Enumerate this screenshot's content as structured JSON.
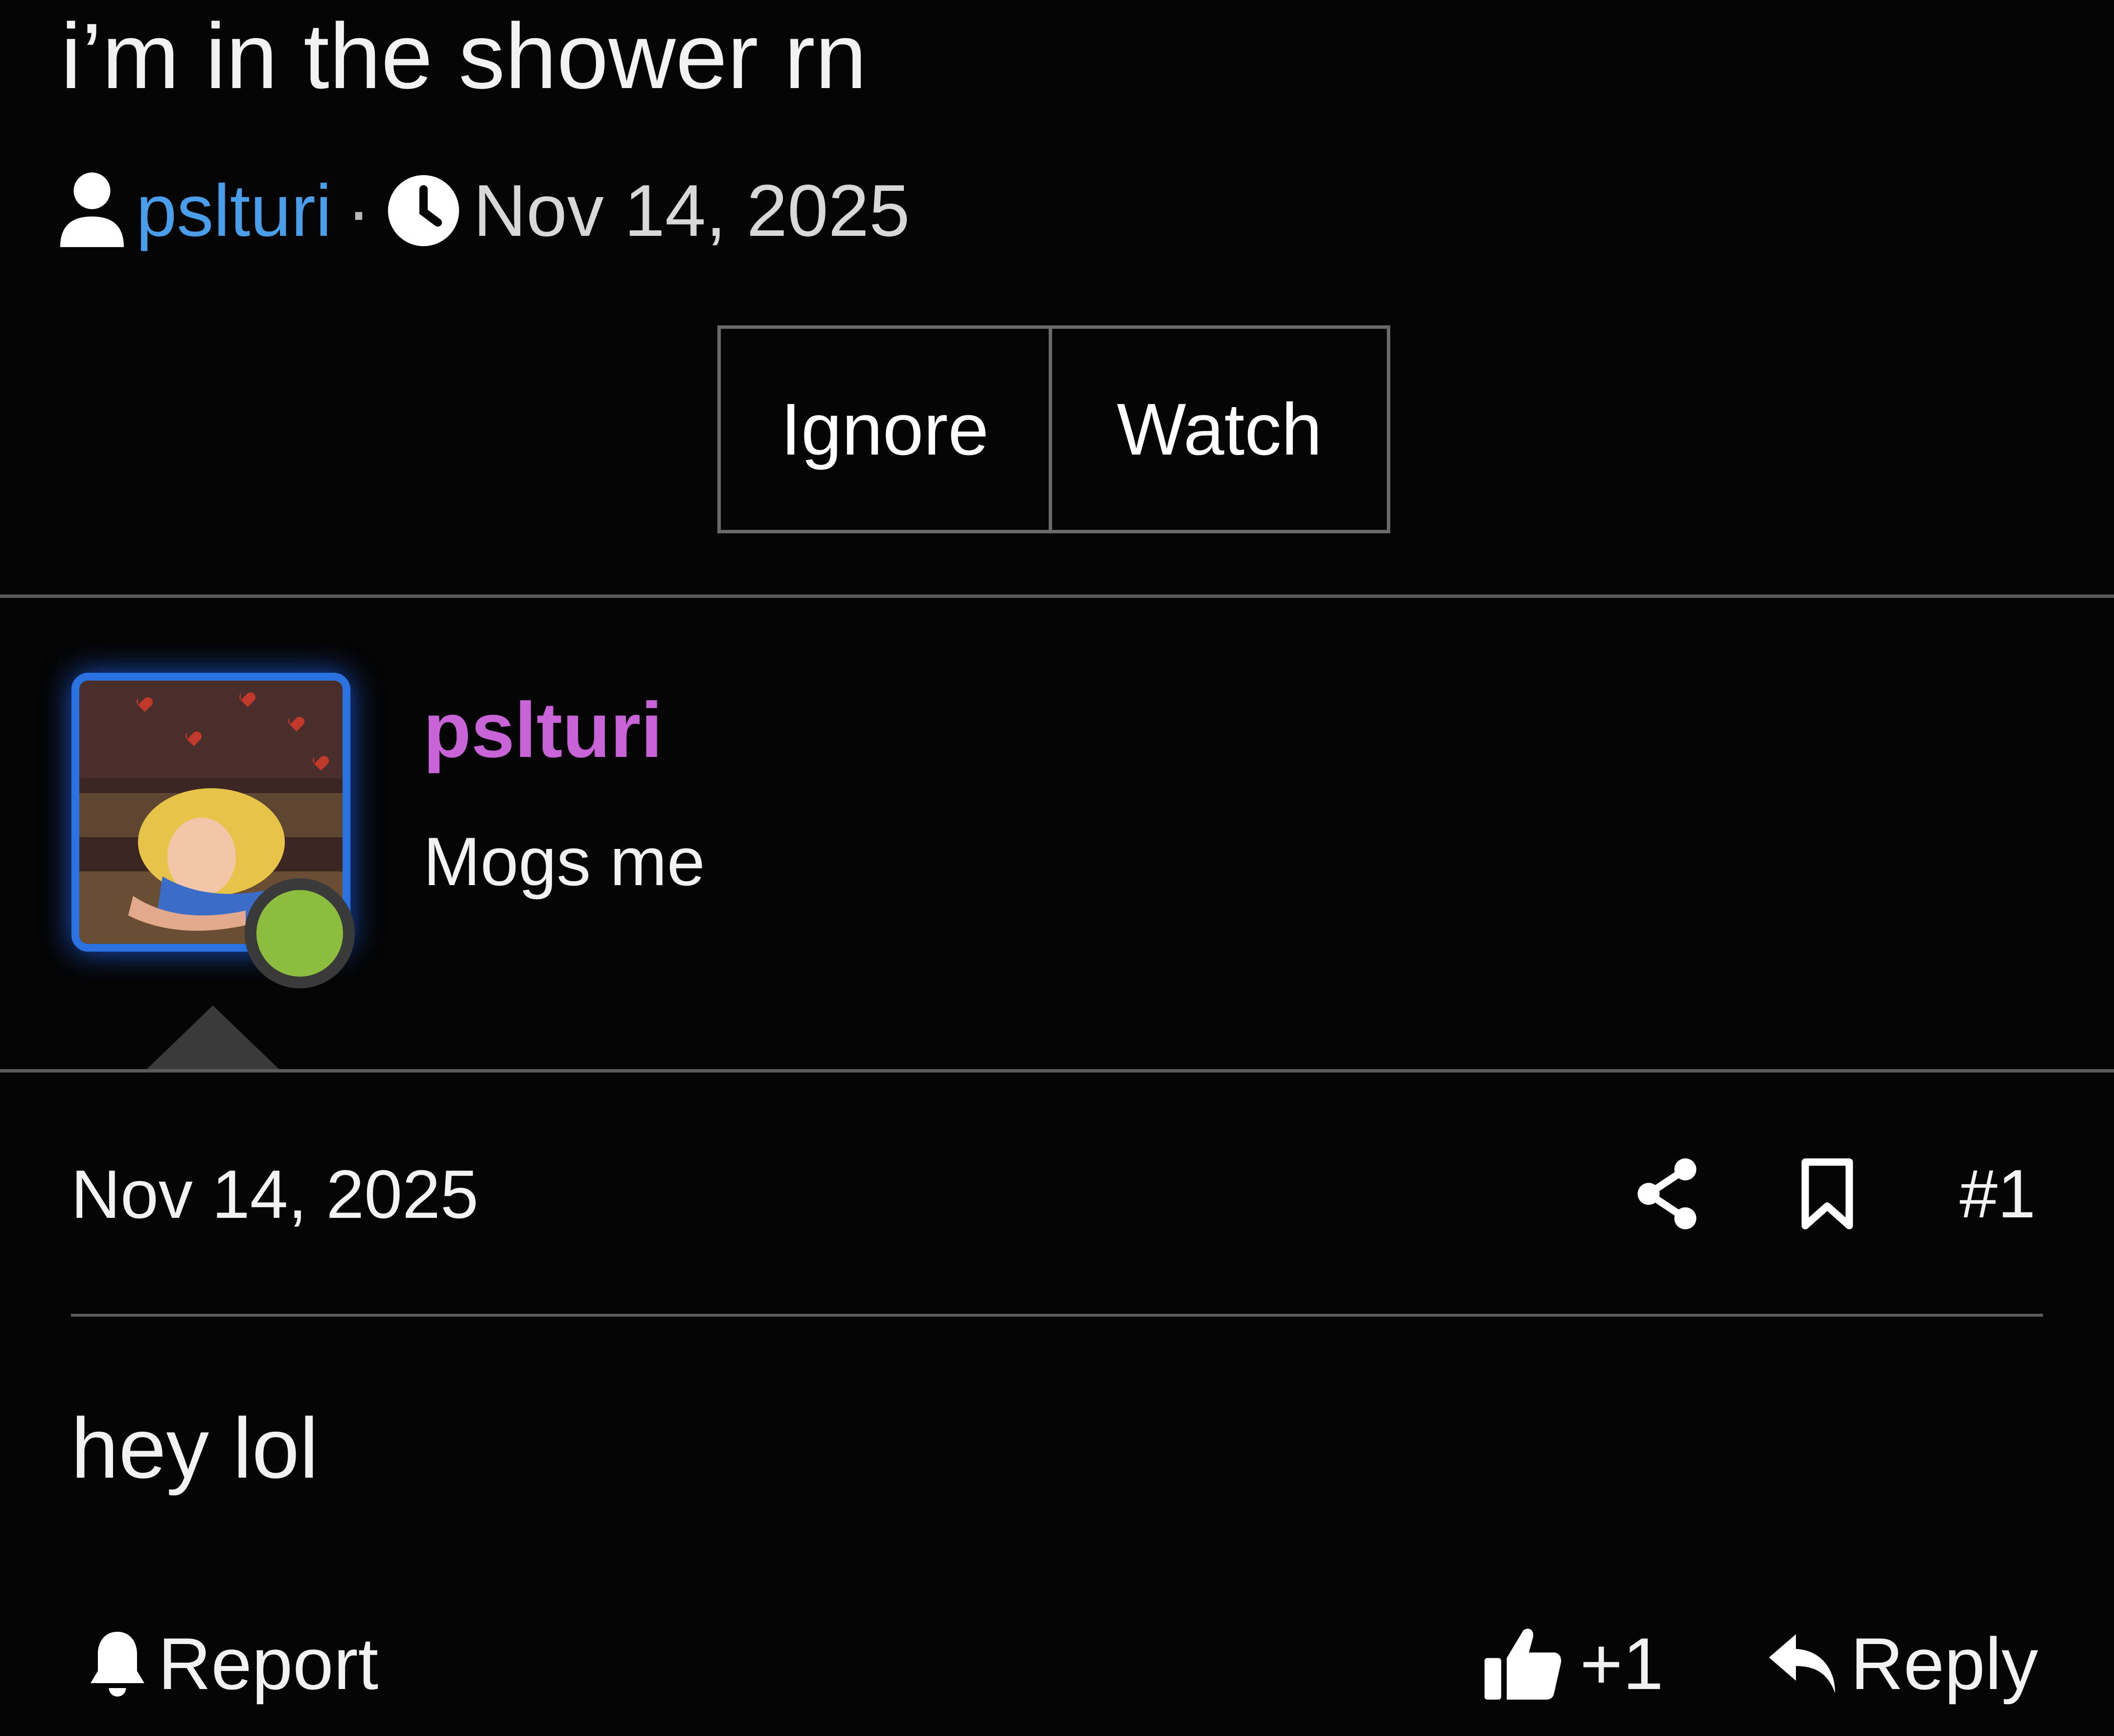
{
  "thread": {
    "title": "i’m in the shower rn",
    "author": "pslturi",
    "separator": "·",
    "date": "Nov 14, 2025"
  },
  "buttons": {
    "ignore": "Ignore",
    "watch": "Watch"
  },
  "post": {
    "username": "pslturi",
    "user_title": "Mogs me",
    "date": "Nov 14, 2025",
    "number": "#1",
    "body": "hey lol",
    "online": true
  },
  "actions": {
    "report": "Report",
    "like_count": "+1",
    "reply": "Reply"
  },
  "icons": [
    "user-icon",
    "clock-icon",
    "share-icon",
    "bookmark-icon",
    "bell-icon",
    "thumbs-up-icon",
    "reply-icon"
  ],
  "colors": {
    "author_link": "#4a9de8",
    "username": "#c864d8",
    "avatar_border": "#2a72e0",
    "online": "#8dbd3e"
  }
}
